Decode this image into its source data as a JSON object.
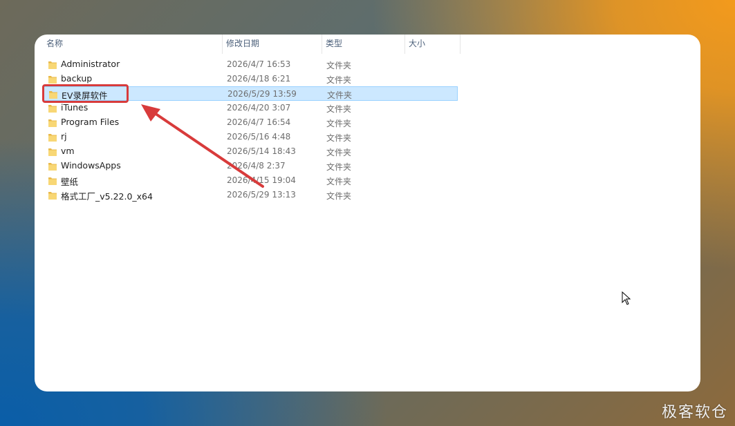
{
  "columns": {
    "name": "名称",
    "date": "修改日期",
    "type": "类型",
    "size": "大小"
  },
  "rows": [
    {
      "name": "Administrator",
      "date": "2026/4/7 16:53",
      "type": "文件夹"
    },
    {
      "name": "backup",
      "date": "2026/4/18 6:21",
      "type": "文件夹"
    },
    {
      "name": "EV录屏软件",
      "date": "2026/5/29 13:59",
      "type": "文件夹",
      "selected": true
    },
    {
      "name": "iTunes",
      "date": "2026/4/20 3:07",
      "type": "文件夹"
    },
    {
      "name": "Program Files",
      "date": "2026/4/7 16:54",
      "type": "文件夹"
    },
    {
      "name": "rj",
      "date": "2026/5/16 4:48",
      "type": "文件夹"
    },
    {
      "name": "vm",
      "date": "2026/5/14 18:43",
      "type": "文件夹"
    },
    {
      "name": "WindowsApps",
      "date": "2026/4/8 2:37",
      "type": "文件夹"
    },
    {
      "name": "壁纸",
      "date": "2026/4/15 19:04",
      "type": "文件夹"
    },
    {
      "name": "格式工厂_v5.22.0_x64",
      "date": "2026/5/29 13:13",
      "type": "文件夹"
    }
  ],
  "icons": {
    "folder": "folder-icon",
    "sort": "sort-up-icon",
    "cursor": "mouse-pointer-icon"
  },
  "colors": {
    "selection_bg": "#cce8ff",
    "selection_border": "#99d1ff",
    "annotation_red": "#d83b3b",
    "folder_yellow": "#f8d775"
  },
  "watermark": "极客软仓"
}
